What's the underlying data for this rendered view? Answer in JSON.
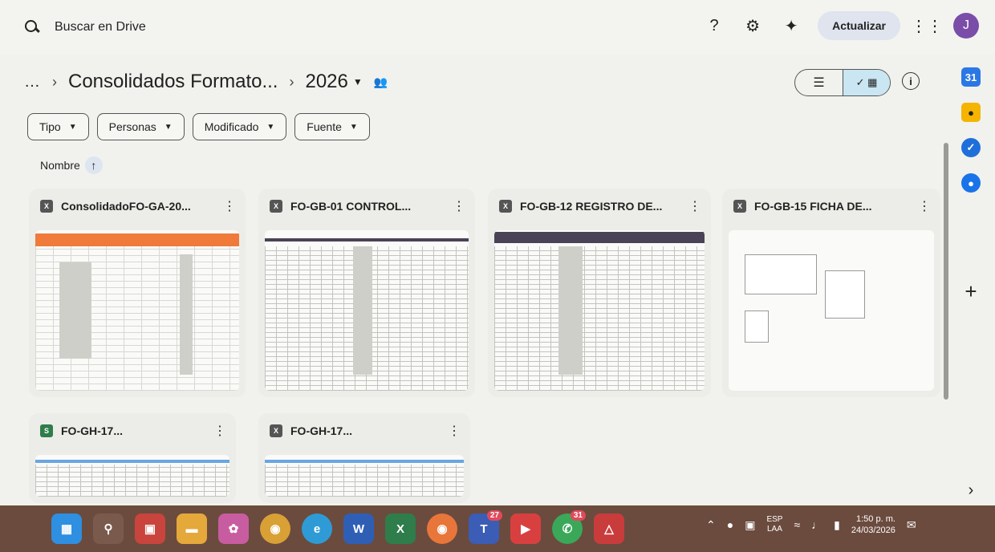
{
  "search": {
    "placeholder": "Buscar en Drive"
  },
  "topbar": {
    "update_label": "Actualizar",
    "avatar_letter": "J"
  },
  "breadcrumb": {
    "more": "…",
    "folder": "Consolidados Formato...",
    "current": "2026"
  },
  "filters": [
    "Tipo",
    "Personas",
    "Modificado",
    "Fuente"
  ],
  "sort": {
    "label": "Nombre",
    "direction": "ascending"
  },
  "files": [
    {
      "name": "ConsolidadoFO-GA-20...",
      "type": "excel"
    },
    {
      "name": "FO-GB-01 CONTROL...",
      "type": "excel"
    },
    {
      "name": "FO-GB-12 REGISTRO DE...",
      "type": "excel"
    },
    {
      "name": "FO-GB-15 FICHA DE...",
      "type": "excel"
    },
    {
      "name": "FO-GH-17...",
      "type": "sheets"
    },
    {
      "name": "FO-GH-17...",
      "type": "excel"
    }
  ],
  "taskbar": {
    "badges": {
      "teams": "27",
      "whatsapp": "31"
    },
    "language": [
      "ESP",
      "LAA"
    ],
    "time": "1:50 p. m.",
    "date": "24/03/2026"
  },
  "colors": {
    "avatar": "#7a4da8",
    "update_button": "#dfe4ee",
    "grid_toggle_active": "#c9e6f2",
    "taskbar": "#6b4b3e",
    "sheet_header_orange": "#f07a3a",
    "sheet_header_dark": "#4a4256"
  }
}
